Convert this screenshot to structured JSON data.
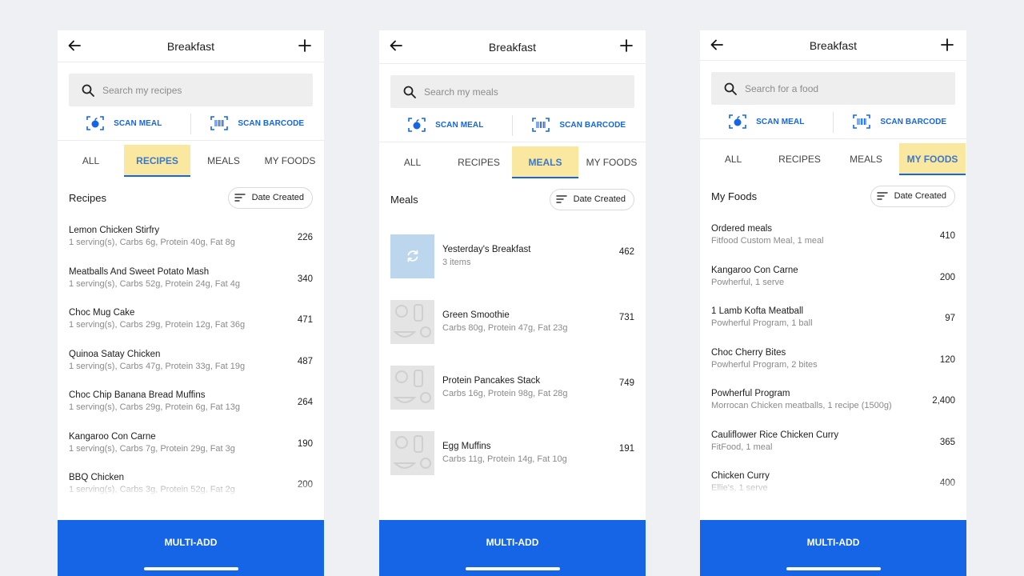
{
  "screens": [
    {
      "header": {
        "title": "Breakfast"
      },
      "search": {
        "placeholder": "Search my recipes"
      },
      "scan_meal_label": "SCAN MEAL",
      "scan_barcode_label": "SCAN BARCODE",
      "tabs": [
        "ALL",
        "RECIPES",
        "MEALS",
        "MY FOODS"
      ],
      "active_tab": "RECIPES",
      "section_title": "Recipes",
      "sort_label": "Date Created",
      "items": [
        {
          "name": "Lemon Chicken Stirfry",
          "detail": "1 serving(s), Carbs 6g, Protein 40g, Fat 8g",
          "calories": "226"
        },
        {
          "name": "Meatballs And Sweet Potato Mash",
          "detail": "1 serving(s), Carbs 52g, Protein 24g, Fat 4g",
          "calories": "340"
        },
        {
          "name": "Choc Mug Cake",
          "detail": "1 serving(s), Carbs 29g, Protein 12g, Fat 36g",
          "calories": "471"
        },
        {
          "name": "Quinoa Satay Chicken",
          "detail": "1 serving(s), Carbs 47g, Protein 33g, Fat 19g",
          "calories": "487"
        },
        {
          "name": "Choc Chip Banana Bread Muffins",
          "detail": "1 serving(s), Carbs 29g, Protein 6g, Fat 13g",
          "calories": "264"
        },
        {
          "name": "Kangaroo Con Carne",
          "detail": "1 serving(s), Carbs 7g, Protein 29g, Fat 3g",
          "calories": "190"
        },
        {
          "name": "BBQ Chicken",
          "detail": "1 serving(s), Carbs 3g, Protein 52g, Fat 2g",
          "calories": "200"
        }
      ],
      "multi_add_label": "MULTI-ADD"
    },
    {
      "header": {
        "title": "Breakfast"
      },
      "search": {
        "placeholder": "Search my meals"
      },
      "scan_meal_label": "SCAN MEAL",
      "scan_barcode_label": "SCAN BARCODE",
      "tabs": [
        "ALL",
        "RECIPES",
        "MEALS",
        "MY FOODS"
      ],
      "active_tab": "MEALS",
      "section_title": "Meals",
      "sort_label": "Date Created",
      "items": [
        {
          "name": "Yesterday's Breakfast",
          "detail": "3 items",
          "calories": "462",
          "thumb": "repeat-icon"
        },
        {
          "name": "Green Smoothie",
          "detail": "Carbs 80g, Protein 47g, Fat 23g",
          "calories": "731",
          "thumb": "food-placeholder"
        },
        {
          "name": "Protein Pancakes Stack",
          "detail": "Carbs 16g, Protein 98g, Fat 28g",
          "calories": "749",
          "thumb": "food-placeholder"
        },
        {
          "name": "Egg Muffins",
          "detail": "Carbs 11g, Protein 14g, Fat 10g",
          "calories": "191",
          "thumb": "food-placeholder"
        }
      ],
      "multi_add_label": "MULTI-ADD"
    },
    {
      "header": {
        "title": "Breakfast"
      },
      "search": {
        "placeholder": "Search for a food"
      },
      "scan_meal_label": "SCAN MEAL",
      "scan_barcode_label": "SCAN BARCODE",
      "tabs": [
        "ALL",
        "RECIPES",
        "MEALS",
        "MY FOODS"
      ],
      "active_tab": "MY FOODS",
      "section_title": "My Foods",
      "sort_label": "Date Created",
      "items": [
        {
          "name": "Ordered meals",
          "detail": "Fitfood Custom Meal, 1 meal",
          "calories": "410"
        },
        {
          "name": "Kangaroo Con Carne",
          "detail": "Powherful, 1 serve",
          "calories": "200"
        },
        {
          "name": "1 Lamb Kofta Meatball",
          "detail": "Powherful Program, 1 ball",
          "calories": "97"
        },
        {
          "name": "Choc Cherry Bites",
          "detail": "Powherful Program, 2 bites",
          "calories": "120"
        },
        {
          "name": "Powherful Program",
          "detail": "Morrocan Chicken meatballs, 1 recipe (1500g)",
          "calories": "2,400"
        },
        {
          "name": "Cauliflower Rice Chicken Curry",
          "detail": "FitFood, 1 meal",
          "calories": "365"
        },
        {
          "name": "Chicken Curry",
          "detail": "Ellie's, 1 serve",
          "calories": "400"
        }
      ],
      "multi_add_label": "MULTI-ADD"
    }
  ],
  "colors": {
    "accent": "#1565e6",
    "active_tab_bg": "#fbe8a0",
    "active_tab_text": "#3a78c9",
    "background": "#eef0f4"
  }
}
